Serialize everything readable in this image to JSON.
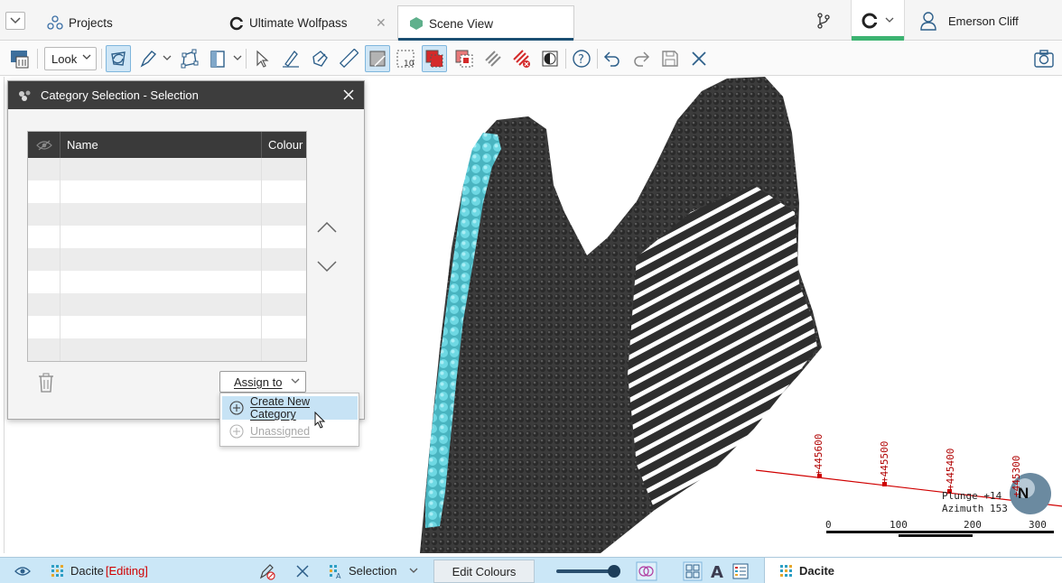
{
  "tabbar": {
    "menu_icon": "chevron-down-icon",
    "tabs": [
      {
        "label": "Projects",
        "icon": "projects-icon"
      },
      {
        "label": "Ultimate Wolfpass",
        "icon": "project-logo-icon"
      },
      {
        "label": "Scene View",
        "icon": "scene-view-icon",
        "active": true
      }
    ],
    "user_name": "Emerson Cliff",
    "accent": "#1b4f72",
    "connected_color": "#3cb371"
  },
  "toolbar": {
    "look_label": "Look"
  },
  "dialog": {
    "title": "Category Selection - Selection",
    "columns": {
      "visibility": "",
      "name": "Name",
      "colour": "Colour"
    },
    "rows": 9,
    "assign_label": "Assign to"
  },
  "menu": {
    "create_label": "Create New Category",
    "unassigned_label": "Unassigned"
  },
  "viewport": {
    "plunge_label": "Plunge +14",
    "azimuth_label": "Azimuth 153",
    "northing_labels": [
      "+445600",
      "+445500",
      "+445400",
      "+445300"
    ],
    "scale_labels": [
      "0",
      "100",
      "200",
      "300"
    ],
    "compass_label": "N",
    "model_color": "#3a3a3a",
    "selection_color": "#5fd3df",
    "axis_color": "#d00000"
  },
  "statusbar": {
    "layer_name": "Dacite",
    "editing_label": "[Editing]",
    "selection_label": "Selection",
    "edit_colours_label": "Edit Colours",
    "right_layer_name": "Dacite"
  }
}
